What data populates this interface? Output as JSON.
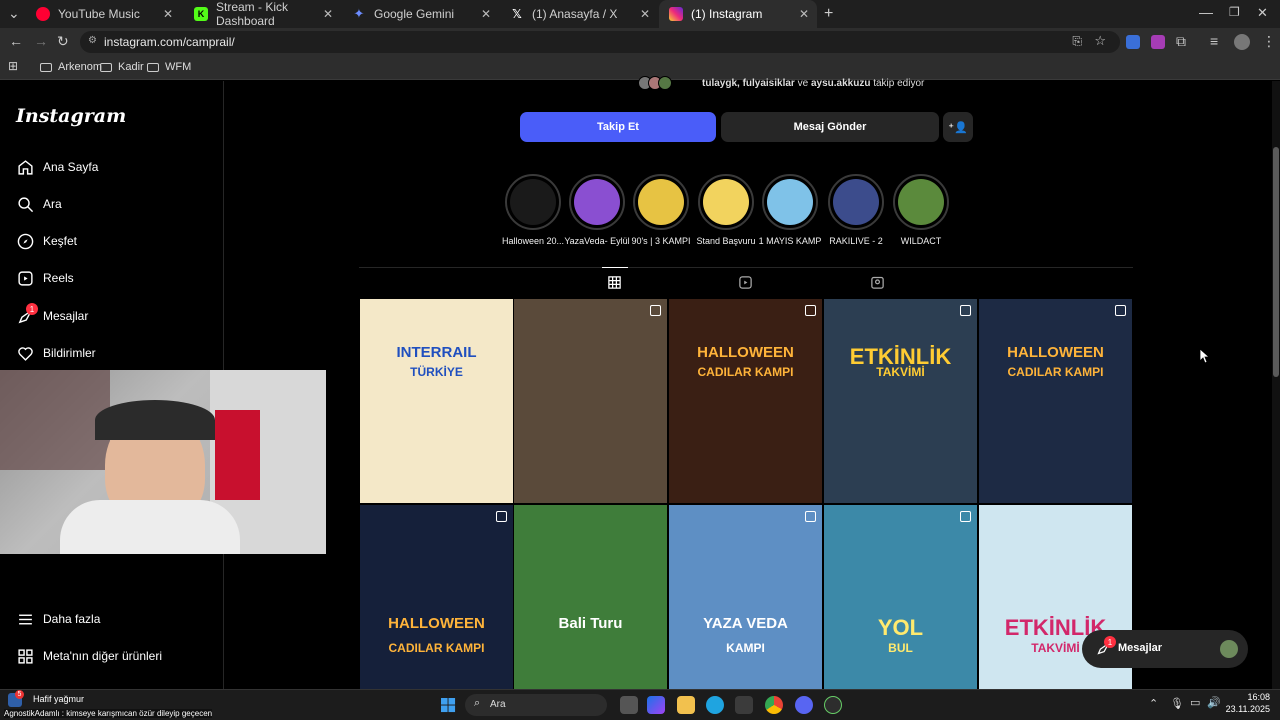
{
  "browser": {
    "tabs": [
      {
        "title": "YouTube Music",
        "color": "#ff0033"
      },
      {
        "title": "Stream - Kick Dashboard",
        "color": "#53fc18"
      },
      {
        "title": "Google Gemini",
        "color": "#6c8cff"
      },
      {
        "title": "(1) Anasayfa / X",
        "color": "#ffffff"
      },
      {
        "title": "(1) Instagram",
        "color": "#e1306c"
      }
    ],
    "url": "instagram.com/camprail/",
    "bookmarks": [
      "Arkenom",
      "Kadir",
      "WFM"
    ]
  },
  "sidebar": {
    "logo": "Instagram",
    "items": [
      {
        "label": "Ana Sayfa",
        "icon": "home-icon"
      },
      {
        "label": "Ara",
        "icon": "search-icon"
      },
      {
        "label": "Keşfet",
        "icon": "compass-icon"
      },
      {
        "label": "Reels",
        "icon": "reels-icon"
      },
      {
        "label": "Mesajlar",
        "icon": "messenger-icon",
        "badge": "1"
      },
      {
        "label": "Bildirimler",
        "icon": "heart-icon"
      }
    ],
    "bottom": [
      {
        "label": "Daha fazla",
        "icon": "menu-icon"
      },
      {
        "label": "Meta'nın diğer ürünleri",
        "icon": "grid-icon"
      }
    ]
  },
  "profile": {
    "followers_prefix": "tulaygk, fulyaisiklar",
    "followers_mid": "ve",
    "followers_last": "aysu.akkuzu",
    "followers_suffix": "takip ediyor",
    "follow_label": "Takip Et",
    "message_label": "Mesaj Gönder",
    "accent": "#4a5df9"
  },
  "highlights": [
    {
      "label": "Halloween 20...",
      "color": "#1a1a1a"
    },
    {
      "label": "YazaVeda- Eylül",
      "color": "#8a4fd1"
    },
    {
      "label": "90's | 3 KAMPI",
      "color": "#e7c343"
    },
    {
      "label": "Stand Başvuru",
      "color": "#f2d35e"
    },
    {
      "label": "1 MAYIS KAMP",
      "color": "#7fc2e8"
    },
    {
      "label": "RAKILIVE - 2",
      "color": "#3c4c8c"
    },
    {
      "label": "WILDACT",
      "color": "#5b8a3c"
    }
  ],
  "posts": [
    {
      "t1": "INTERRAIL",
      "t2": "TÜRKİYE",
      "bg": "#f4e8c8",
      "fg": "#1f4fbf",
      "badge": false
    },
    {
      "t1": "",
      "t2": "",
      "bg": "#5a4a3a",
      "fg": "#ffffff",
      "badge": true
    },
    {
      "t1": "HALLOWEEN",
      "t2": "CADILAR KAMPI",
      "bg": "#3a1f14",
      "fg": "#ffb43a",
      "badge": true
    },
    {
      "t1": "ETKİNLİK",
      "t2": "TAKVİMİ",
      "bg": "#2c3e52",
      "fg": "#ffcc33",
      "badge": true
    },
    {
      "t1": "HALLOWEEN",
      "t2": "CADILAR KAMPI",
      "bg": "#1d2a44",
      "fg": "#ffb43a",
      "badge": true
    },
    {
      "t1": "HALLOWEEN",
      "t2": "CADILAR KAMPI",
      "bg": "#15203a",
      "fg": "#ffb43a",
      "badge": true
    },
    {
      "t1": "Bali Turu",
      "t2": "",
      "bg": "#3f7d3a",
      "fg": "#ffffff",
      "badge": false
    },
    {
      "t1": "YAZA VEDA",
      "t2": "KAMPI",
      "bg": "#5e8fc4",
      "fg": "#ffffff",
      "badge": true
    },
    {
      "t1": "YOL",
      "t2": "BUL",
      "bg": "#3c89a8",
      "fg": "#ffea6e",
      "badge": true
    },
    {
      "t1": "ETKİNLİK",
      "t2": "TAKVİMİ",
      "bg": "#cfe6f0",
      "fg": "#d2276a",
      "badge": false
    }
  ],
  "messages_pill": {
    "label": "Mesajlar",
    "badge": "1"
  },
  "taskbar": {
    "weather": "Hafif yağmur",
    "ticker": "AgnostikAdamlı : kimseye karışmıcan özür dileyip geçecen",
    "search": "Ara",
    "time": "16:08",
    "date": "23.11.2025"
  }
}
